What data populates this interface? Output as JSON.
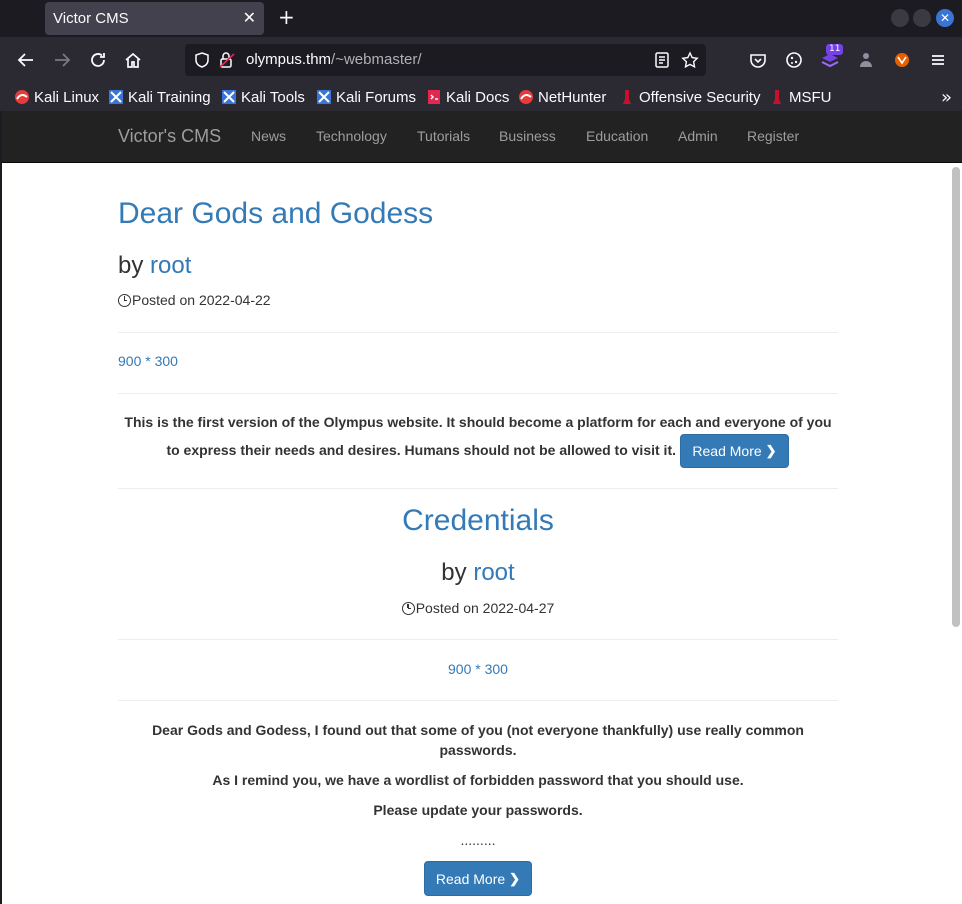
{
  "browser": {
    "tab_title": "Victor CMS",
    "url_host": "olympus.thm",
    "url_path": "/~webmaster/",
    "extension_badge": "11",
    "bookmarks": [
      "Kali Linux",
      "Kali Training",
      "Kali Tools",
      "Kali Forums",
      "Kali Docs",
      "NetHunter",
      "Offensive Security",
      "MSFU"
    ]
  },
  "site_nav": {
    "brand": "Victor's CMS",
    "links": [
      "News",
      "Technology",
      "Tutorials",
      "Business",
      "Education",
      "Admin",
      "Register"
    ]
  },
  "posts": [
    {
      "title": "Dear Gods and Godess",
      "by": "by",
      "author": "root",
      "posted": "Posted on 2022-04-22",
      "image_alt": "900 * 300",
      "body": [
        "This is the first version of the Olympus website. It should become a platform for each and everyone of you",
        "to express their needs and desires. Humans should not be allowed to visit it."
      ],
      "read_more": "Read More"
    },
    {
      "title": "Credentials",
      "by": "by",
      "author": "root",
      "posted": "Posted on 2022-04-27",
      "image_alt": "900 * 300",
      "body": [
        "Dear Gods and Godess, I found out that some of you (not everyone thankfully) use really common",
        "passwords.",
        "As I remind you, we have a wordlist of forbidden password that you should use.",
        "Please update your passwords.",
        "........."
      ],
      "read_more": "Read More"
    }
  ],
  "colors": {
    "link": "#337ab7",
    "nav_bg": "#222222",
    "chrome_bg": "#2b2a33"
  }
}
